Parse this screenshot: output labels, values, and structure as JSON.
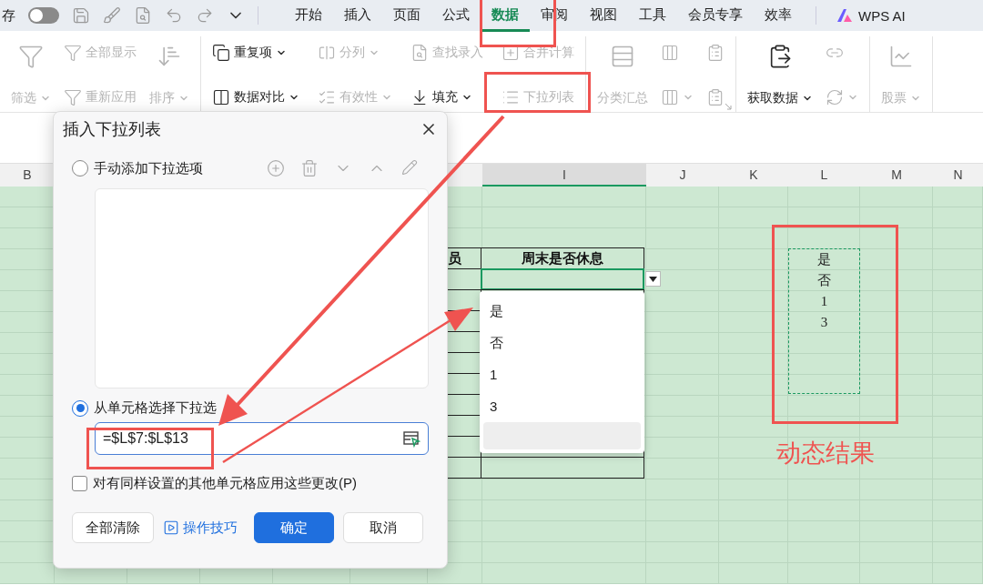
{
  "title_bar": {
    "save_label": "存",
    "autosave_on": false,
    "tabs": [
      {
        "label": "开始",
        "selected": false
      },
      {
        "label": "插入",
        "selected": false
      },
      {
        "label": "页面",
        "selected": false
      },
      {
        "label": "公式",
        "selected": false
      },
      {
        "label": "数据",
        "selected": true
      },
      {
        "label": "审阅",
        "selected": false
      },
      {
        "label": "视图",
        "selected": false
      },
      {
        "label": "工具",
        "selected": false
      },
      {
        "label": "会员专享",
        "selected": false
      },
      {
        "label": "效率",
        "selected": false
      }
    ],
    "ai_label": "WPS AI"
  },
  "ribbon": [
    {
      "columns": [
        {
          "kind": "tall",
          "items": [
            {
              "label": "筛选",
              "disabled": true,
              "caret": true
            }
          ]
        },
        {
          "kind": "pair",
          "items": [
            {
              "label": "全部显示",
              "disabled": true,
              "caret": false
            },
            {
              "label": "重新应用",
              "disabled": true,
              "caret": false
            }
          ]
        },
        {
          "kind": "tall",
          "items": [
            {
              "label": "排序",
              "disabled": true,
              "caret": true
            }
          ]
        }
      ]
    },
    {
      "columns": [
        {
          "kind": "pair",
          "items": [
            {
              "label": "重复项",
              "disabled": false,
              "caret": true
            },
            {
              "label": "数据对比",
              "disabled": false,
              "caret": true
            }
          ]
        },
        {
          "kind": "pair",
          "items": [
            {
              "label": "分列",
              "disabled": true,
              "caret": true
            },
            {
              "label": "有效性",
              "disabled": true,
              "caret": true
            }
          ]
        },
        {
          "kind": "pair",
          "items": [
            {
              "label": "查找录入",
              "disabled": true,
              "caret": false
            },
            {
              "label": "填充",
              "disabled": false,
              "caret": true
            }
          ]
        },
        {
          "kind": "pair",
          "items": [
            {
              "label": "合并计算",
              "disabled": true,
              "caret": false
            },
            {
              "label": "下拉列表",
              "disabled": true,
              "caret": false
            }
          ]
        }
      ]
    },
    {
      "columns": [
        {
          "kind": "tall",
          "items": [
            {
              "label": "分类汇总",
              "disabled": true,
              "caret": false
            }
          ]
        },
        {
          "kind": "pair",
          "items": [
            {
              "disabled": true,
              "caret": false
            },
            {
              "disabled": true,
              "caret": true
            }
          ]
        },
        {
          "kind": "pair",
          "items": [
            {
              "disabled": true,
              "caret": false
            },
            {
              "disabled": true,
              "caret": false
            }
          ]
        }
      ]
    },
    {
      "columns": [
        {
          "kind": "tall",
          "items": [
            {
              "label": "获取数据",
              "disabled": false,
              "caret": true
            }
          ]
        },
        {
          "kind": "pair",
          "items": [
            {
              "disabled": true,
              "caret": false
            },
            {
              "disabled": true,
              "caret": true
            }
          ]
        }
      ]
    },
    {
      "columns": [
        {
          "kind": "tall",
          "items": [
            {
              "label": "股票",
              "disabled": true,
              "caret": true
            }
          ]
        }
      ]
    }
  ],
  "sheet": {
    "columns": [
      {
        "label": "B",
        "selected": false
      },
      {
        "label": "I",
        "selected": true
      },
      {
        "label": "J",
        "selected": false
      },
      {
        "label": "K",
        "selected": false
      },
      {
        "label": "L",
        "selected": false
      },
      {
        "label": "M",
        "selected": false
      },
      {
        "label": "N",
        "selected": false
      }
    ],
    "table_header": [
      "员",
      "周末是否休息"
    ],
    "table_rows": [
      {
        "selected": true
      },
      {
        "selected": false
      },
      {
        "selected": false
      },
      {
        "selected": false
      },
      {
        "selected": false
      },
      {
        "selected": false
      },
      {
        "selected": false
      },
      {
        "selected": false
      },
      {
        "selected": false
      },
      {
        "selected": false
      }
    ],
    "source_values": [
      "是",
      "否",
      "1",
      "3"
    ]
  },
  "dropdown": {
    "options": [
      {
        "label": "是"
      },
      {
        "label": "否"
      },
      {
        "label": "1"
      },
      {
        "label": "3"
      }
    ],
    "blank_row_hovered": true
  },
  "dialog": {
    "title": "插入下拉列表",
    "manual_option": {
      "label": "手动添加下拉选项",
      "selected": false
    },
    "cell_option": {
      "label": "从单元格选择下拉选",
      "selected": true
    },
    "range_value": "=$L$7:$L$13",
    "apply_all": {
      "label": "对有同样设置的其他单元格应用这些更改(P)",
      "checked": false
    },
    "buttons": {
      "clear": "全部清除",
      "tips": "操作技巧",
      "ok": "确定",
      "cancel": "取消"
    }
  },
  "annotation": {
    "label": "动态结果"
  }
}
